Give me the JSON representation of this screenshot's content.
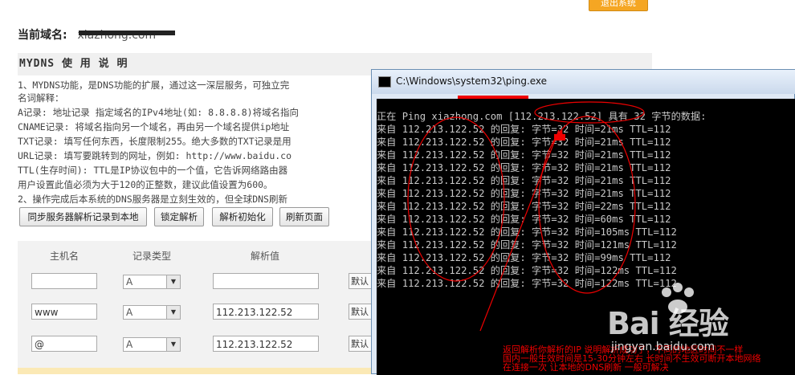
{
  "header": {
    "logout_label": "退出系统",
    "domain_label": "当前域名:",
    "domain_value": "xiazhong.com"
  },
  "mydns": {
    "heading": "MYDNS 使 用 说 明",
    "lines": [
      "1、MYDNS功能，是DNS功能的扩展，通过这一深层服务，可独立完",
      "名词解释：",
      "A记录: 地址记录 指定域名的IPv4地址(如: 8.8.8.8)将域名指向",
      "CNAME记录: 将域名指向另一个域名，再由另一个域名提供ip地址",
      "TXT记录: 填写任何东西，长度限制255。绝大多数的TXT记录是用",
      "URL记录: 填写要跳转到的网址，例如: http://www.baidu.co",
      "TTL(生存时间): TTL是IP协议包中的一个值，它告诉网络路由器",
      "用户设置此值必须为大于120的正整数，建议此值设置为600。",
      "2、操作完成后本系统的DNS服务器是立刻生效的，但全球DNS刷新"
    ]
  },
  "buttons": {
    "sync": "同步服务器解析记录到本地",
    "lock": "锁定解析",
    "init": "解析初始化",
    "refresh": "刷新页面"
  },
  "table": {
    "headers": {
      "host": "主机名",
      "type": "记录类型",
      "value": "解析值"
    },
    "rows": [
      {
        "host": "",
        "type": "A",
        "value": "",
        "extra": "默认"
      },
      {
        "host": "www",
        "type": "A",
        "value": "112.213.122.52",
        "extra": "默认"
      },
      {
        "host": "@",
        "type": "A",
        "value": "112.213.122.52",
        "extra": "默认"
      }
    ]
  },
  "console": {
    "title": "C:\\Windows\\system32\\ping.exe",
    "header_line": "正在 Ping xiazhong.com [112.213.122.52] 具有 32 字节的数据:",
    "lines": [
      "来自 112.213.122.52 的回复: 字节=32 时间=21ms TTL=112",
      "来自 112.213.122.52 的回复: 字节=32 时间=21ms TTL=112",
      "来自 112.213.122.52 的回复: 字节=32 时间=21ms TTL=112",
      "来自 112.213.122.52 的回复: 字节=32 时间=21ms TTL=112",
      "来自 112.213.122.52 的回复: 字节=32 时间=21ms TTL=112",
      "来自 112.213.122.52 的回复: 字节=32 时间=21ms TTL=112",
      "来自 112.213.122.52 的回复: 字节=32 时间=22ms TTL=112",
      "来自 112.213.122.52 的回复: 字节=32 时间=60ms TTL=112",
      "来自 112.213.122.52 的回复: 字节=32 时间=105ms TTL=112",
      "来自 112.213.122.52 的回复: 字节=32 时间=121ms TTL=112",
      "来自 112.213.122.52 的回复: 字节=32 时间=99ms TTL=112",
      "来自 112.213.122.52 的回复: 字节=32 时间=122ms TTL=112",
      "来自 112.213.122.52 的回复: 字节=32 时间=122ms TTL=112"
    ]
  },
  "annotation": {
    "lines": [
      "返回解析你解析的IP 说明解析成功了，不同的地区时间不一样",
      "国内一般生效时间是15-30分钟左右 长时间不生效可断开本地网络",
      "在连接一次 让本地的DNS刷新 一般可解决"
    ],
    "color": "#e00000"
  },
  "watermark": {
    "brand": "Bai 经验",
    "url": "jingyan.baidu.com"
  }
}
